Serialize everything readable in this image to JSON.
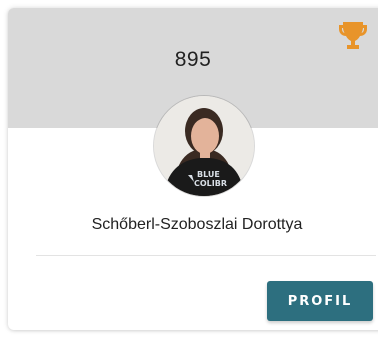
{
  "card": {
    "score": "895",
    "trophy_icon": "trophy-icon",
    "avatar_icon": "profile-photo",
    "avatar_shirt_text": [
      "BLUE",
      "COLIBR"
    ],
    "name": "Schőberl-Szoboszlai Dorottya",
    "profile_button_label": "PROFIL"
  },
  "colors": {
    "header_bg": "#d9d9d9",
    "trophy": "#e8942a",
    "button_bg": "#2d6f7f",
    "button_text": "#ffffff"
  }
}
